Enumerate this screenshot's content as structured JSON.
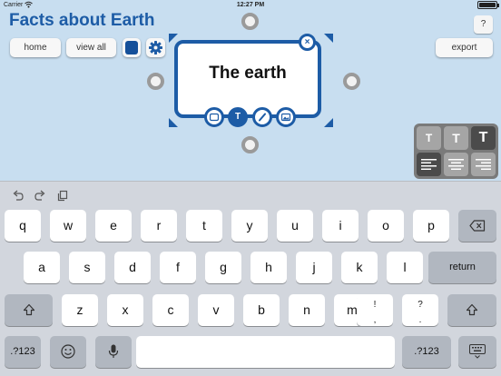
{
  "status_bar": {
    "carrier": "Carrier",
    "time": "12:27 PM"
  },
  "header": {
    "title": "Facts about Earth",
    "help_label": "?"
  },
  "toolbar": {
    "home_label": "home",
    "view_all_label": "view all",
    "export_label": "export",
    "selected_color": "#15509a"
  },
  "card": {
    "text": "The earth",
    "close_label": "×",
    "text_tool_label": "T",
    "border_color": "#1d5ca6"
  },
  "format_panel": {
    "sizes": [
      "T",
      "T",
      "T"
    ],
    "selected_size_index": 2,
    "alignments": [
      "align-left-icon",
      "align-center-icon",
      "align-right-icon"
    ],
    "selected_alignment_index": 0
  },
  "keyboard": {
    "row1": [
      "q",
      "w",
      "e",
      "r",
      "t",
      "y",
      "u",
      "i",
      "o",
      "p"
    ],
    "row2": [
      "a",
      "s",
      "d",
      "f",
      "g",
      "h",
      "j",
      "k",
      "l"
    ],
    "row2_return": "return",
    "row3": [
      "z",
      "x",
      "c",
      "v",
      "b",
      "n",
      "m"
    ],
    "row3_punct1": [
      "!",
      ","
    ],
    "row3_punct2": [
      "?",
      "."
    ],
    "numbers_label": ".?123"
  }
}
